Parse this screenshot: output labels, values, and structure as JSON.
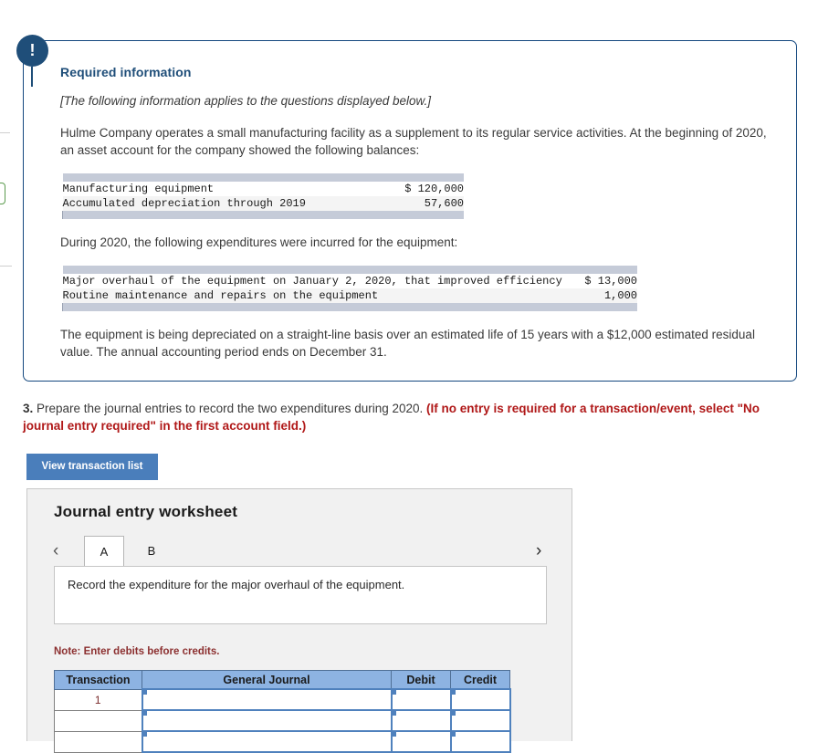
{
  "alert": {
    "glyph": "!"
  },
  "required_info": {
    "title": "Required information",
    "italic_note": "[The following information applies to the questions displayed below.]",
    "intro_paragraph": "Hulme Company operates a small manufacturing facility as a supplement to its regular service activities. At the beginning of 2020, an asset account for the company showed the following balances:",
    "balances_table": {
      "rows": [
        {
          "label": "Manufacturing equipment",
          "amount": "$ 120,000"
        },
        {
          "label": "Accumulated depreciation through 2019",
          "amount": "57,600"
        }
      ]
    },
    "expenditures_intro": "During 2020, the following expenditures were incurred for the equipment:",
    "expenditures_table": {
      "rows": [
        {
          "label": "Major overhaul of the equipment on January 2, 2020, that improved efficiency",
          "amount": "$ 13,000"
        },
        {
          "label": "Routine maintenance and repairs on the equipment",
          "amount": "1,000"
        }
      ]
    },
    "depreciation_paragraph": "The equipment is being depreciated on a straight-line basis over an estimated life of 15 years with a $12,000 estimated residual value. The annual accounting period ends on December 31."
  },
  "question": {
    "number": "3.",
    "text": " Prepare the journal entries to record the two expenditures during 2020. ",
    "red_text": "(If no entry is required for a transaction/event, select \"No journal entry required\" in the first account field.)"
  },
  "buttons": {
    "view_transaction_list": "View transaction list"
  },
  "worksheet": {
    "title": "Journal entry worksheet",
    "tabs": [
      {
        "label": "A",
        "active": true
      },
      {
        "label": "B",
        "active": false
      }
    ],
    "prev_chevron": "‹",
    "next_chevron": "›",
    "prompt": "Record the expenditure for the major overhaul of the equipment.",
    "note": "Note: Enter debits before credits.",
    "table": {
      "headers": [
        "Transaction",
        "General Journal",
        "Debit",
        "Credit"
      ],
      "rows": [
        {
          "transaction": "1",
          "general_journal": "",
          "debit": "",
          "credit": ""
        },
        {
          "transaction": "",
          "general_journal": "",
          "debit": "",
          "credit": ""
        },
        {
          "transaction": "",
          "general_journal": "",
          "debit": "",
          "credit": ""
        }
      ]
    }
  },
  "colors": {
    "panel_border": "#14487f",
    "title_blue": "#1f4e79",
    "alert_blue": "#1f4e79",
    "button_blue": "#4a7ebb",
    "warning_red": "#b01818",
    "note_red": "#8c3030",
    "table_header_blue": "#8db3e2",
    "input_border_blue": "#4f81bd"
  }
}
